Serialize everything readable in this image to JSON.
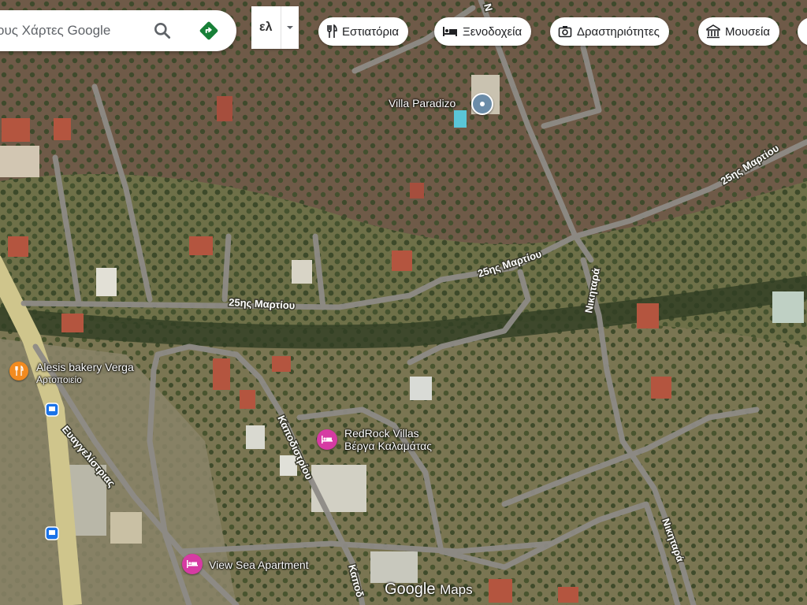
{
  "search": {
    "placeholder": "ους Χάρτες Google"
  },
  "language": {
    "value": "ελ"
  },
  "chips": [
    {
      "label": "Εστιατόρια",
      "icon": "restaurant-icon"
    },
    {
      "label": "Ξενοδοχεία",
      "icon": "hotel-icon"
    },
    {
      "label": "Δραστηριότητες",
      "icon": "camera-icon"
    },
    {
      "label": "Μουσεία",
      "icon": "museum-icon"
    }
  ],
  "roads": [
    {
      "name": "25ης Μαρτίου"
    },
    {
      "name": "25ης Μαρτίου"
    },
    {
      "name": "25ης Μαρτίου"
    },
    {
      "name": "Νικηταρά"
    },
    {
      "name": "Νικηταρά"
    },
    {
      "name": "Καποδιστρίου"
    },
    {
      "name": "Καποδ"
    },
    {
      "name": "Ευαγγελίστριας"
    },
    {
      "name": "Ν"
    }
  ],
  "places": {
    "villa": {
      "name": "Villa Paradizo"
    },
    "bakery": {
      "name": "Alesis bakery Verga",
      "category": "Αρτοποιείο"
    },
    "redrock": {
      "name_line1": "RedRock Villas",
      "name_line2": "Βέργα Καλαμάτας"
    },
    "viewsea": {
      "name": "View Sea Apartment"
    }
  },
  "watermark": {
    "google": "Google",
    "maps": "Maps"
  },
  "colors": {
    "accent_green": "#188038",
    "hotel_pin": "#d63ba3",
    "food_pin": "#f28b20",
    "place_pin": "#6b8ca8"
  }
}
